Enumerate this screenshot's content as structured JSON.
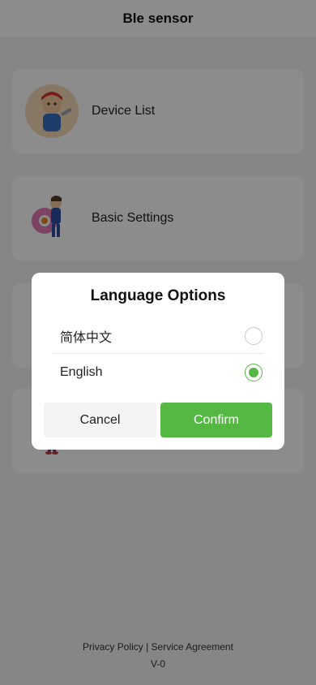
{
  "app": {
    "title": "Ble sensor"
  },
  "menu": {
    "items": [
      {
        "label": "Device List",
        "icon": "mechanic-boy-icon"
      },
      {
        "label": "Basic Settings",
        "icon": "gear-mechanic-icon"
      },
      {
        "label": "",
        "icon": "tools-icon"
      },
      {
        "label": "",
        "icon": "worker-icon"
      }
    ]
  },
  "footer": {
    "privacy": "Privacy Policy",
    "separator": "|",
    "service": "Service Agreement",
    "version": "V-0"
  },
  "dialog": {
    "title": "Language Options",
    "options": [
      {
        "label": "简体中文",
        "selected": false
      },
      {
        "label": "English",
        "selected": true
      }
    ],
    "cancel_label": "Cancel",
    "confirm_label": "Confirm"
  },
  "colors": {
    "accent": "#54b842",
    "overlay": "rgba(0,0,0,0.45)"
  }
}
